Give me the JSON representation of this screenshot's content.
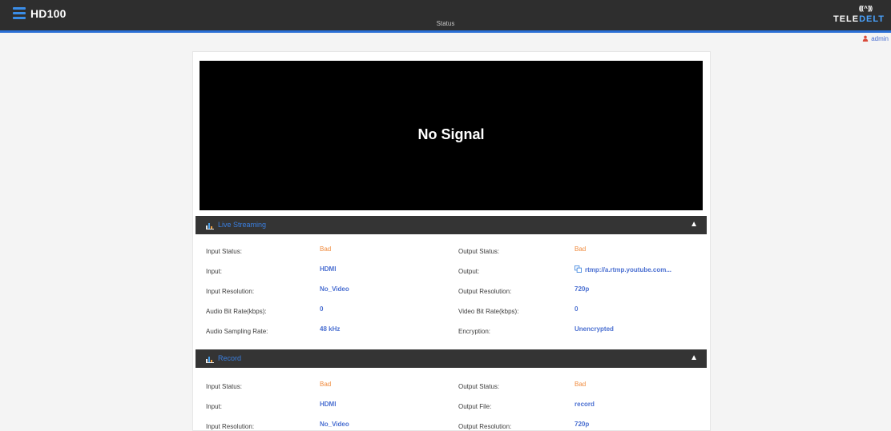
{
  "header": {
    "brand": "HD100",
    "page_title": "Status",
    "logo_waves": "((( ^ )))",
    "logo_part1": "TELE",
    "logo_part2": "DELT",
    "user": "admin"
  },
  "video": {
    "message": "No Signal"
  },
  "live_streaming": {
    "title": "Live Streaming",
    "rows": [
      {
        "l1": "Input Status:",
        "v1": "Bad",
        "l2": "Output Status:",
        "v2": "Bad"
      },
      {
        "l1": "Input:",
        "v1": "HDMI",
        "l2": "Output:",
        "v2": "rtmp://a.rtmp.youtube.com..."
      },
      {
        "l1": "Input Resolution:",
        "v1": "No_Video",
        "l2": "Output Resolution:",
        "v2": "720p"
      },
      {
        "l1": "Audio Bit Rate(kbps):",
        "v1": "0",
        "l2": "Video Bit Rate(kbps):",
        "v2": "0"
      },
      {
        "l1": "Audio Sampling Rate:",
        "v1": "48 kHz",
        "l2": "Encryption:",
        "v2": "Unencrypted"
      }
    ]
  },
  "record": {
    "title": "Record",
    "rows": [
      {
        "l1": "Input Status:",
        "v1": "Bad",
        "l2": "Output Status:",
        "v2": "Bad"
      },
      {
        "l1": "Input:",
        "v1": "HDMI",
        "l2": "Output File:",
        "v2": "record"
      },
      {
        "l1": "Input Resolution:",
        "v1": "No_Video",
        "l2": "Output Resolution:",
        "v2": "720p"
      }
    ]
  },
  "colors": {
    "accent": "#2a6fd6",
    "bad": "#f08a3c",
    "value": "#4a6fd1",
    "header_bg": "#2e2e2e"
  },
  "icons": {
    "menu": "menu-icon",
    "user": "user-icon",
    "section": "bar-chart-icon",
    "collapse": "chevron-up-icon",
    "copy": "copy-icon"
  }
}
